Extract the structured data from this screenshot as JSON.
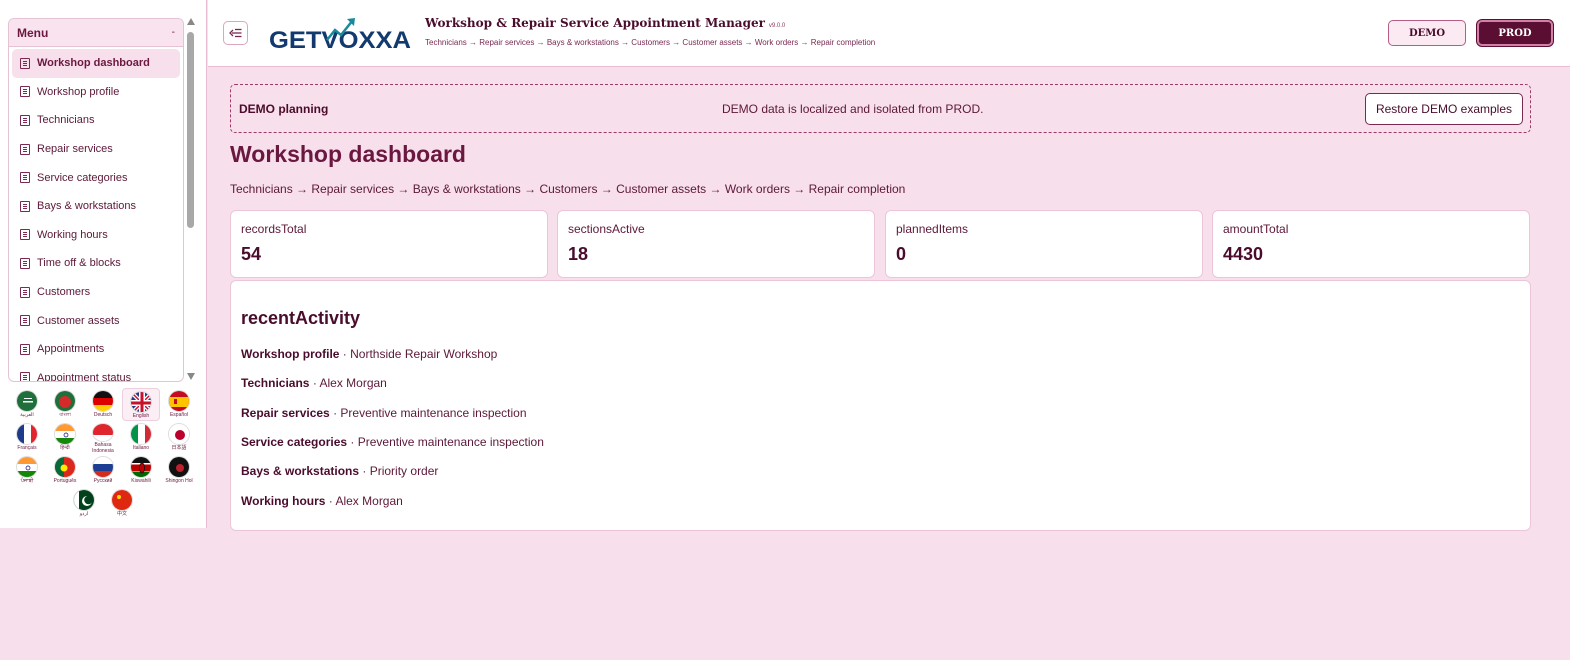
{
  "sidebar": {
    "menu_title": "Menu",
    "collapse_glyph": "-",
    "items": [
      {
        "label": "Workshop dashboard",
        "active": true
      },
      {
        "label": "Workshop profile"
      },
      {
        "label": "Technicians"
      },
      {
        "label": "Repair services"
      },
      {
        "label": "Service categories"
      },
      {
        "label": "Bays & workstations"
      },
      {
        "label": "Working hours"
      },
      {
        "label": "Time off & blocks"
      },
      {
        "label": "Customers"
      },
      {
        "label": "Customer assets"
      },
      {
        "label": "Appointments"
      },
      {
        "label": "Appointment status"
      }
    ],
    "languages": [
      {
        "label": "العربية",
        "flag": "saudi-arabia-flag"
      },
      {
        "label": "বাংলা",
        "flag": "bangladesh-flag"
      },
      {
        "label": "Deutsch",
        "flag": "germany-flag"
      },
      {
        "label": "English",
        "flag": "uk-flag",
        "selected": true
      },
      {
        "label": "Español",
        "flag": "spain-flag"
      },
      {
        "label": "Français",
        "flag": "france-flag"
      },
      {
        "label": "हिन्दी",
        "flag": "india-flag"
      },
      {
        "label": "Bahasa Indonesia",
        "flag": "indonesia-flag"
      },
      {
        "label": "Italiano",
        "flag": "italy-flag"
      },
      {
        "label": "日本語",
        "flag": "japan-flag"
      },
      {
        "label": "ਪੰਜਾਬੀ",
        "flag": "india-flag"
      },
      {
        "label": "Português",
        "flag": "portugal-flag"
      },
      {
        "label": "Русский",
        "flag": "russia-flag"
      },
      {
        "label": "Kiswahili",
        "flag": "kenya-flag"
      },
      {
        "label": "Shingon Hol",
        "flag": "dark-flag"
      },
      {
        "label": "اردو",
        "flag": "pakistan-flag"
      },
      {
        "label": "中文",
        "flag": "china-flag"
      }
    ]
  },
  "header": {
    "logo_text": "GETVOXXA",
    "app_title": "Workshop & Repair Service Appointment Manager",
    "version": "v9.0.0",
    "flow": "Technicians → Repair services → Bays & workstations → Customers → Customer assets → Work orders → Repair completion",
    "demo_label": "DEMO",
    "prod_label": "PROD"
  },
  "banner": {
    "title": "DEMO planning",
    "message": "DEMO data is localized and isolated from PROD.",
    "restore_label": "Restore DEMO examples"
  },
  "main": {
    "page_title": "Workshop dashboard",
    "breadcrumb": "Technicians → Repair services → Bays & workstations → Customers → Customer assets → Work orders → Repair completion",
    "stats": [
      {
        "label": "recordsTotal",
        "value": "54"
      },
      {
        "label": "sectionsActive",
        "value": "18"
      },
      {
        "label": "plannedItems",
        "value": "0"
      },
      {
        "label": "amountTotal",
        "value": "4430"
      }
    ],
    "activity_title": "recentActivity",
    "activity": [
      {
        "section": "Workshop profile",
        "detail": "· Northside Repair Workshop"
      },
      {
        "section": "Technicians",
        "detail": "· Alex Morgan"
      },
      {
        "section": "Repair services",
        "detail": "· Preventive maintenance inspection"
      },
      {
        "section": "Service categories",
        "detail": "· Preventive maintenance inspection"
      },
      {
        "section": "Bays & workstations",
        "detail": "· Priority order"
      },
      {
        "section": "Working hours",
        "detail": "· Alex Morgan"
      }
    ]
  },
  "colors": {
    "accent": "#5a0f32",
    "background": "#f8dfec",
    "text": "#5c1838"
  }
}
